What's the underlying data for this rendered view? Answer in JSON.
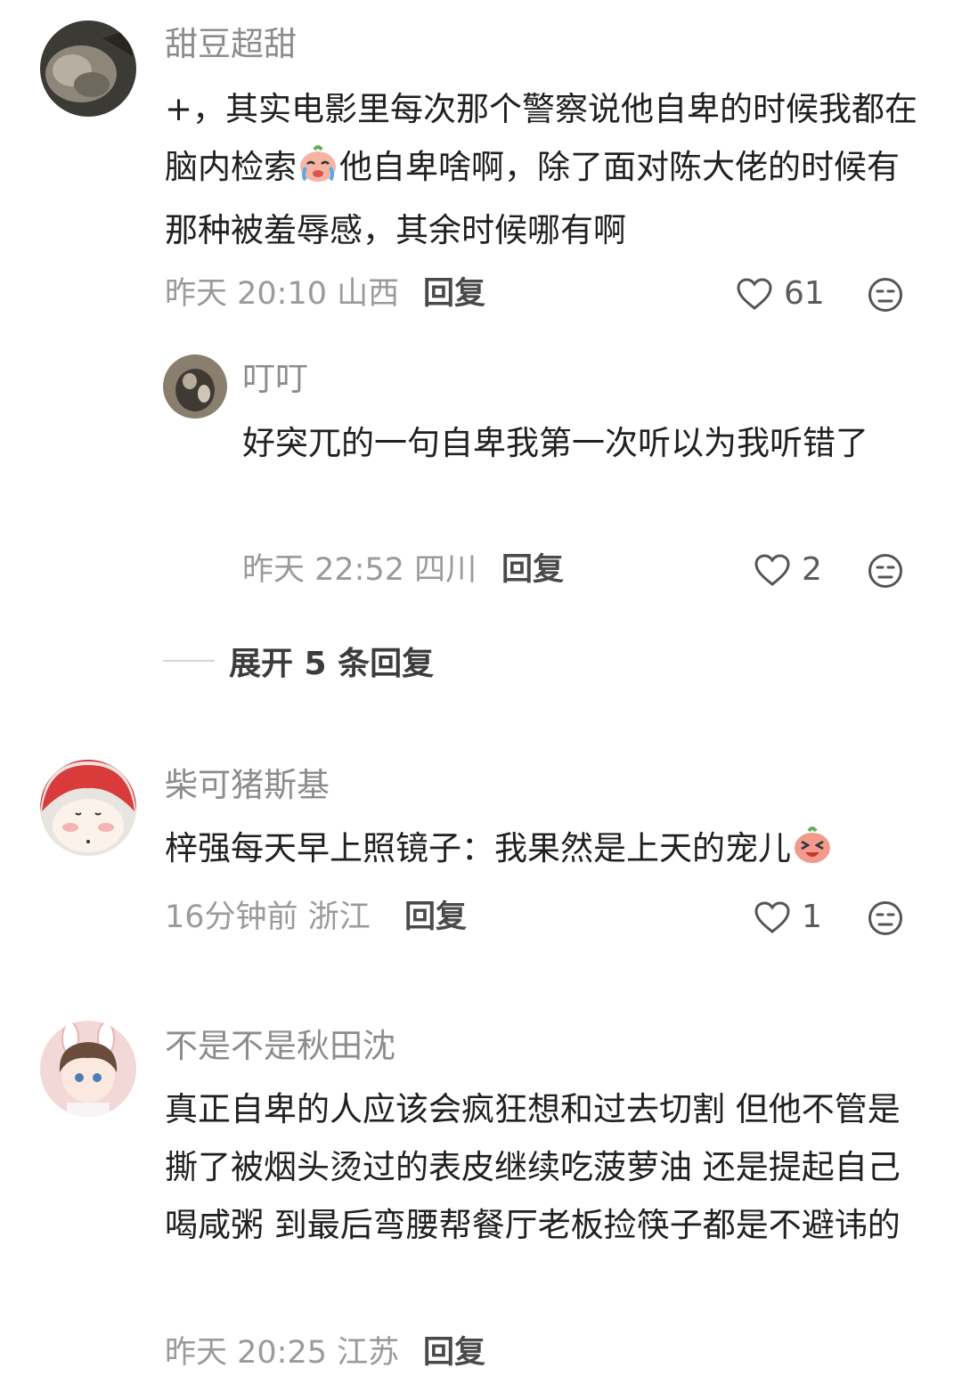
{
  "comments": [
    {
      "username": "甜豆超甜",
      "text_a": "+，其实电影里每次那个警察说他自卑的时候我都在脑内检索",
      "emoji": "crying-face-emoji",
      "text_b": "他自卑啥啊，除了面对陈大佬的时候有那种被羞辱感，其余时候哪有啊",
      "time": "昨天 20:10",
      "region": "山西",
      "reply_label": "回复",
      "likes": "61",
      "sub_reply": {
        "username": "叮叮",
        "text": "好突兀的一句自卑我第一次听以为我听错了",
        "time": "昨天 22:52",
        "region": "四川",
        "reply_label": "回复",
        "likes": "2"
      },
      "expand_label": "展开 5 条回复"
    },
    {
      "username": "柴可猪斯基",
      "text_a": "梓强每天早上照镜子：我果然是上天的宠儿",
      "emoji": "laughing-face-emoji",
      "time": "16分钟前",
      "region": "浙江",
      "reply_label": "回复",
      "likes": "1"
    },
    {
      "username": "不是不是秋田沈",
      "text_a": "真正自卑的人应该会疯狂想和过去切割 但他不管是撕了被烟头烫过的表皮继续吃菠萝油 还是提起自己喝咸粥 到最后弯腰帮餐厅老板捡筷子都是不避讳的",
      "time": "昨天 20:25",
      "region": "江苏",
      "reply_label": "回复"
    }
  ],
  "colors": {
    "meta": "#9a9a9a",
    "username": "#8c8c8c",
    "text": "#202020"
  }
}
